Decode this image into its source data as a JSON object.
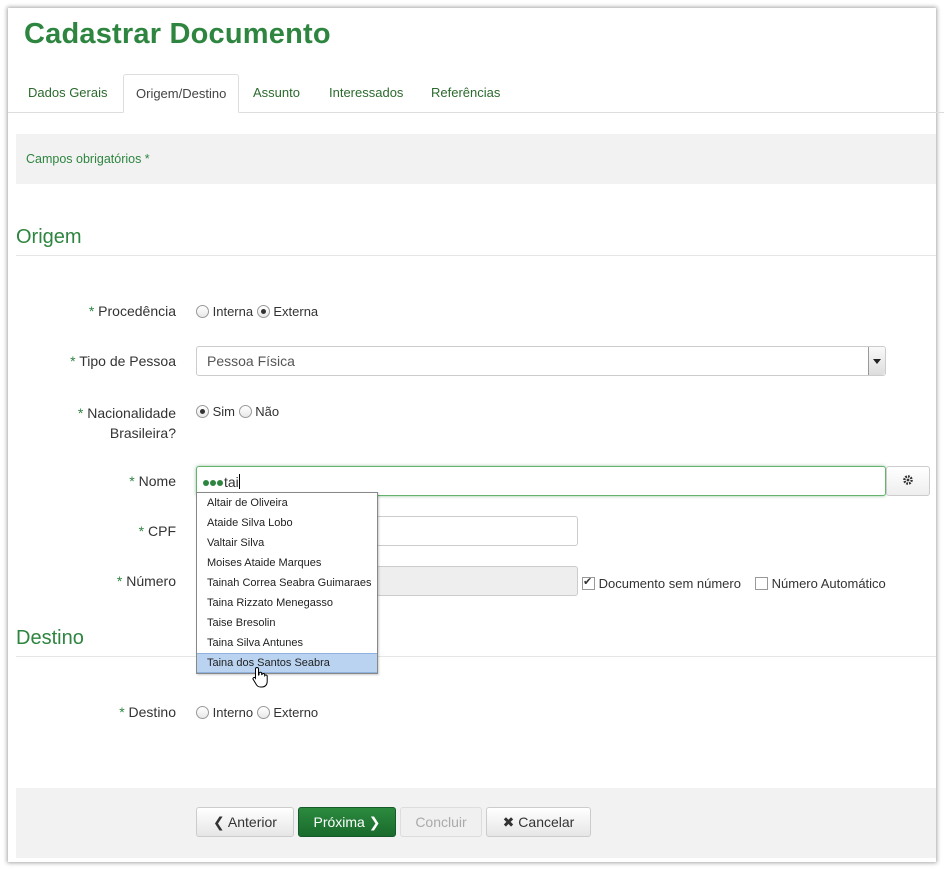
{
  "page_title": "Cadastrar Documento",
  "tabs": [
    {
      "label": "Dados Gerais"
    },
    {
      "label": "Origem/Destino"
    },
    {
      "label": "Assunto"
    },
    {
      "label": "Interessados"
    },
    {
      "label": "Referências"
    }
  ],
  "required_note": "Campos obrigatórios *",
  "origem": {
    "section_title": "Origem",
    "procedencia": {
      "label": "Procedência",
      "options": [
        "Interna",
        "Externa"
      ],
      "selected": "Externa"
    },
    "tipo_pessoa": {
      "label": "Tipo de Pessoa",
      "value": "Pessoa Física"
    },
    "nacionalidade": {
      "label_line1": "Nacionalidade",
      "label_line2": "Brasileira?",
      "options": [
        "Sim",
        "Não"
      ],
      "selected": "Sim"
    },
    "nome": {
      "label": "Nome",
      "value": "tai"
    },
    "cpf": {
      "label": "CPF",
      "value": ""
    },
    "numero": {
      "label": "Número",
      "value": "",
      "sem_numero_label": "Documento sem número",
      "sem_numero_checked": true,
      "automatico_label": "Número Automático",
      "automatico_checked": false
    }
  },
  "autocomplete": {
    "items": [
      "Altair de Oliveira",
      "Ataide Silva Lobo",
      "Valtair Silva",
      "Moises Ataide Marques",
      "Tainah Correa Seabra Guimaraes",
      "Taina Rizzato Menegasso",
      "Taise Bresolin",
      "Taina Silva Antunes",
      "Taina dos Santos Seabra"
    ],
    "highlighted_index": 8
  },
  "destino": {
    "section_title": "Destino",
    "destino": {
      "label": "Destino",
      "options": [
        "Interno",
        "Externo"
      ],
      "selected": ""
    }
  },
  "buttons": {
    "anterior": "Anterior",
    "proxima": "Próxima",
    "concluir": "Concluir",
    "cancelar": "Cancelar"
  },
  "required_mark": "*",
  "colors": {
    "brand_green": "#2e8540",
    "primary_button": "#1f7a33",
    "highlight": "#b9d3f0"
  }
}
